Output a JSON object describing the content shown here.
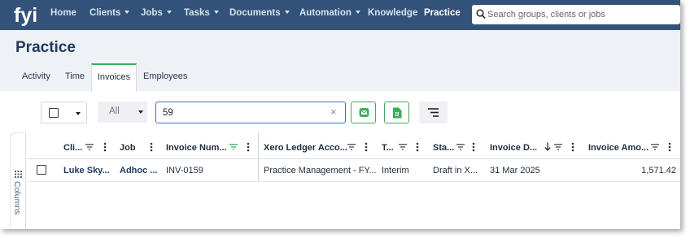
{
  "nav": {
    "logo_text": "fyi",
    "items": [
      {
        "label": "Home",
        "caret": false
      },
      {
        "label": "Clients",
        "caret": true
      },
      {
        "label": "Jobs",
        "caret": true
      },
      {
        "label": "Tasks",
        "caret": true
      },
      {
        "label": "Documents",
        "caret": true
      },
      {
        "label": "Automation",
        "caret": true
      },
      {
        "label": "Knowledge",
        "caret": false
      },
      {
        "label": "Practice",
        "caret": false
      }
    ],
    "search_placeholder": "Search groups, clients or jobs"
  },
  "page": {
    "title": "Practice",
    "tabs": [
      "Activity",
      "Time",
      "Invoices",
      "Employees"
    ],
    "active_tab": "Invoices"
  },
  "toolbar": {
    "status_select": "All",
    "filter_value": "59",
    "clear_symbol": "×"
  },
  "grid": {
    "columns_label": "Columns",
    "headers": [
      "Cli...",
      "Job",
      "Invoice Num...",
      "Xero Ledger Acco...",
      "T...",
      "Sta...",
      "Invoice D...",
      "Invoice Amo..."
    ],
    "rows": [
      [
        "Luke Sky...",
        "Adhoc ...",
        "INV-0159",
        "Practice Management - FY...",
        "Interim",
        "Draft in X...",
        "31 Mar 2025",
        "1,571.42"
      ]
    ]
  },
  "colors": {
    "nav_bg": "#33527a",
    "accent_green": "#3fae5a",
    "focus_blue": "#2f73c9"
  },
  "icons": [
    "search-icon",
    "caret-down-icon",
    "clear-icon",
    "email-icon",
    "excel-export-icon",
    "sort-lines-icon",
    "filter-icon",
    "column-menu-icon",
    "sort-desc-icon",
    "grid-icon"
  ]
}
